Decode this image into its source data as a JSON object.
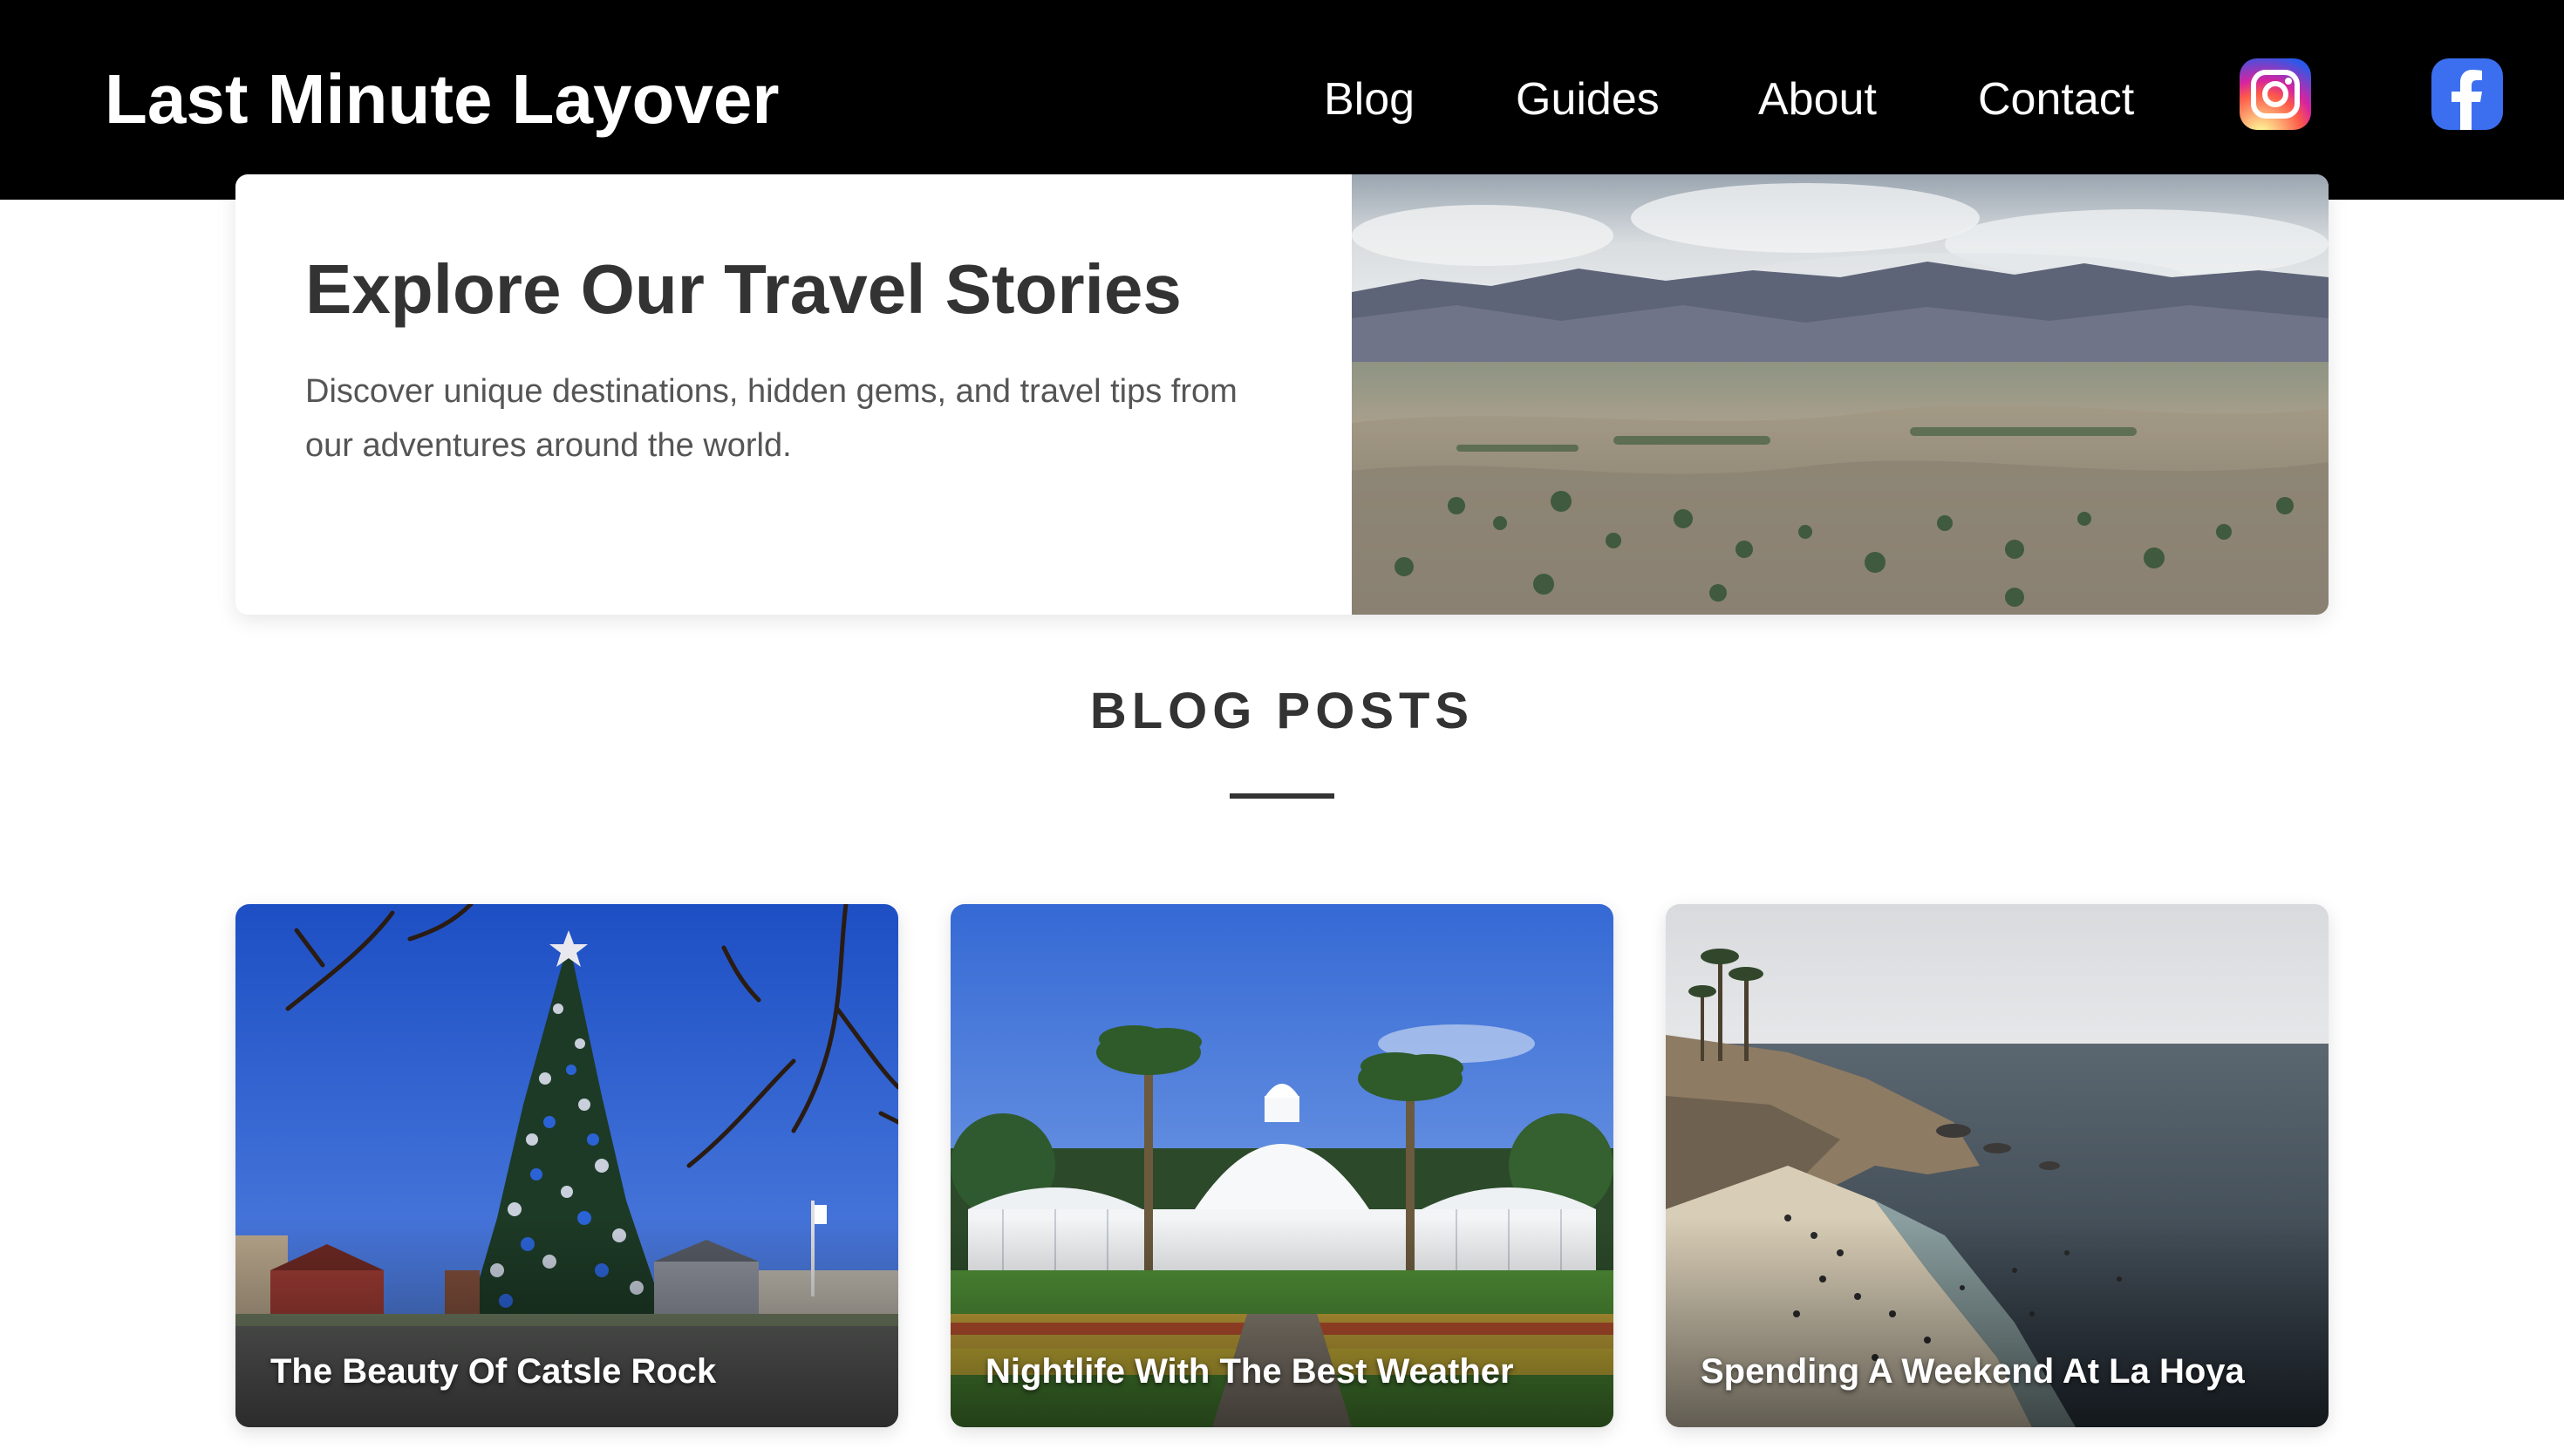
{
  "header": {
    "brand": "Last Minute Layover",
    "nav": {
      "blog": "Blog",
      "guides": "Guides",
      "about": "About",
      "contact": "Contact"
    },
    "social": {
      "instagram_icon": "instagram-icon",
      "facebook_icon": "facebook-icon"
    }
  },
  "hero": {
    "title": "Explore Our Travel Stories",
    "text": "Discover unique destinations, hidden gems, and travel tips from our adventures around the world.",
    "image": "mountain-valley-landscape"
  },
  "blog": {
    "heading": "BLOG POSTS",
    "posts": [
      {
        "title": "The Beauty Of Catsle Rock",
        "image": "christmas-tree-town-square"
      },
      {
        "title": "Nightlife With The Best Weather",
        "image": "white-conservatory-gardens"
      },
      {
        "title": "Spending A Weekend At La Hoya",
        "image": "ocean-cove-beach"
      }
    ]
  },
  "colors": {
    "header_bg": "#000000",
    "header_text": "#ffffff",
    "body_text": "#333333",
    "muted_text": "#555555",
    "facebook_blue": "#3b6ff0"
  }
}
